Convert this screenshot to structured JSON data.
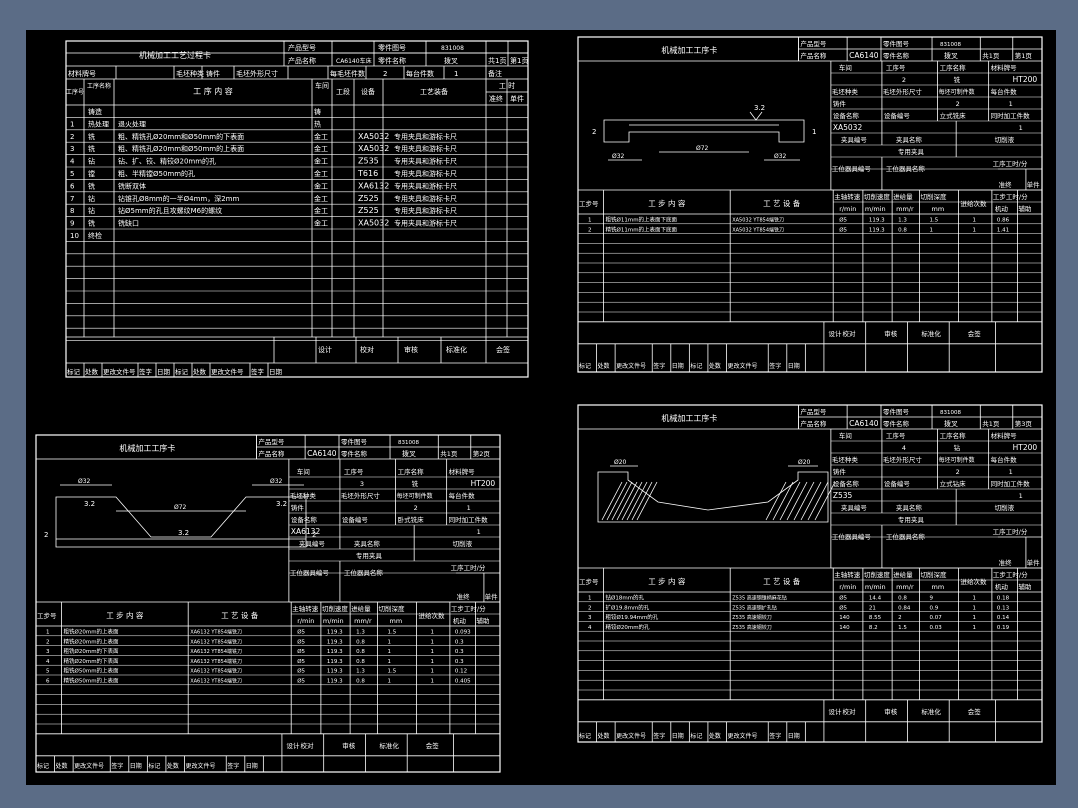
{
  "sheet1": {
    "title": "机械加工工艺过程卡",
    "hdr": {
      "prod_model_lbl": "产品型号",
      "part_no_lbl": "零件图号",
      "part_no": "831008",
      "prod_name_lbl": "产品名称",
      "prod_name": "CA6140车床",
      "part_name_lbl": "零件名称",
      "part_name": "拨叉",
      "total_pages": "共1页",
      "page_no": "第1页",
      "material_lbl": "材料牌号",
      "blank_type_lbl": "毛坯种类",
      "blank_type": "铸件",
      "blank_dim_lbl": "毛坯外形尺寸",
      "per_blank_lbl": "每毛坯件数",
      "per_blank": "2",
      "per_unit_lbl": "每台件数",
      "per_unit": "1",
      "remark_lbl": "备注"
    },
    "cols": {
      "op_no": "工序号",
      "op_name": "工序名称",
      "op_content": "工 序 内 容",
      "workshop": "车间",
      "section": "工段",
      "equipment": "设备",
      "tooling": "工艺装备",
      "time": "工 时",
      "time_final": "准终",
      "time_unit": "单件"
    },
    "rows": [
      {
        "no": "",
        "name": "铸造",
        "content": "",
        "shop": "铸",
        "equip": "",
        "tool": ""
      },
      {
        "no": "1",
        "name": "热处理",
        "content": "退火处理",
        "shop": "热",
        "equip": "",
        "tool": ""
      },
      {
        "no": "2",
        "name": "铣",
        "content": "粗、精铣孔Ø20mm和Ø50mm的下表面",
        "shop": "金工",
        "equip": "XA5032",
        "tool": "专用夹具和游标卡尺"
      },
      {
        "no": "3",
        "name": "铣",
        "content": "粗、精铣孔Ø20mm和Ø50mm的上表面",
        "shop": "金工",
        "equip": "XA5032",
        "tool": "专用夹具和游标卡尺"
      },
      {
        "no": "4",
        "name": "钻",
        "content": "钻、扩、铰、精铰Ø20mm的孔",
        "shop": "金工",
        "equip": "Z535",
        "tool": "专用夹具和游标卡尺"
      },
      {
        "no": "5",
        "name": "镗",
        "content": "粗、半精镗Ø50mm的孔",
        "shop": "金工",
        "equip": "T616",
        "tool": "专用夹具和游标卡尺"
      },
      {
        "no": "6",
        "name": "铣",
        "content": "铣断双体",
        "shop": "金工",
        "equip": "XA6132",
        "tool": "专用夹具和游标卡尺"
      },
      {
        "no": "7",
        "name": "钻",
        "content": "钻锥孔Ø8mm的一半Ø4mm，深2mm",
        "shop": "金工",
        "equip": "Z525",
        "tool": "专用夹具和游标卡尺"
      },
      {
        "no": "8",
        "name": "钻",
        "content": "钻Ø5mm的孔且攻螺纹M6的螺纹",
        "shop": "金工",
        "equip": "Z525",
        "tool": "专用夹具和游标卡尺"
      },
      {
        "no": "9",
        "name": "铣",
        "content": "铣缺口",
        "shop": "金工",
        "equip": "XA5032",
        "tool": "专用夹具和游标卡尺"
      },
      {
        "no": "10",
        "name": "终检",
        "content": "",
        "shop": "",
        "equip": "",
        "tool": ""
      }
    ],
    "sign": {
      "design": "设计",
      "check": "校对",
      "review": "审核",
      "standard": "标准化",
      "countersign": "会签"
    },
    "rev": [
      "标记",
      "处数",
      "更改文件号",
      "签字",
      "日期",
      "标记",
      "处数",
      "更改文件号",
      "签字",
      "日期"
    ]
  },
  "op_cards": [
    {
      "title": "机械加工工序卡",
      "prod_model_lbl": "产品型号",
      "part_no_lbl": "零件图号",
      "part_no": "831008",
      "prod_name_lbl": "产品名称",
      "prod_name": "CA6140",
      "part_name_lbl": "零件名称",
      "part_name": "拨叉",
      "total_pages": "共1页",
      "page_no": "第1页",
      "workshop_lbl": "车间",
      "op_no_lbl": "工序号",
      "op_name_lbl": "工序名称",
      "material_lbl": "材料牌号",
      "op_no": "2",
      "op_name": "铣",
      "material": "HT200",
      "blank_type_lbl": "毛坯种类",
      "blank_dim_lbl": "毛坯外形尺寸",
      "blank_count_lbl": "每坯可制件数",
      "per_unit_lbl": "每台件数",
      "blank_type": "铸件",
      "blank_count": "2",
      "per_unit": "1",
      "equip_name_lbl": "设备名称",
      "equip_model_lbl": "设备编号",
      "concurrent_lbl": "同时加工件数",
      "equip_name": "立式铣床",
      "equip_model": "XA5032",
      "concurrent": "1",
      "fixture_no_lbl": "夹具编号",
      "fixture_name_lbl": "夹具名称",
      "coolant_lbl": "切削液",
      "fixture_name": "专用夹具",
      "tool_no_lbl": "工位器具编号",
      "tool_name_lbl": "工位器具名称",
      "op_time_lbl": "工序工时/分",
      "time_final": "准终",
      "time_unit": "单件",
      "drawing": {
        "roughness": "3.2",
        "d1": "Ø32",
        "d2": "Ø72",
        "d3": "Ø32",
        "l": "2",
        "r": "1"
      },
      "steps": [
        {
          "no": "1",
          "content": "粗铣Ø11mm的上表面下底面",
          "equip": "XA5032  YT854端铣刀",
          "rpm": "Ø5",
          "speed": "119.3",
          "feed": "1.3",
          "depth": "1.5",
          "passes": "1",
          "t": "0.86"
        },
        {
          "no": "2",
          "content": "精铣Ø11mm的上表面下底面",
          "equip": "XA5032  YT854端铣刀",
          "rpm": "Ø5",
          "speed": "119.3",
          "feed": "0.8",
          "depth": "1",
          "passes": "1",
          "t": "1.41"
        }
      ]
    },
    {
      "title": "机械加工工序卡",
      "prod_model_lbl": "产品型号",
      "part_no_lbl": "零件图号",
      "part_no": "831008",
      "prod_name_lbl": "产品名称",
      "prod_name": "CA6140",
      "part_name_lbl": "零件名称",
      "part_name": "拨叉",
      "total_pages": "共1页",
      "page_no": "第2页",
      "workshop_lbl": "车间",
      "op_no_lbl": "工序号",
      "op_name_lbl": "工序名称",
      "material_lbl": "材料牌号",
      "op_no": "3",
      "op_name": "铣",
      "material": "HT200",
      "blank_type_lbl": "毛坯种类",
      "blank_dim_lbl": "毛坯外形尺寸",
      "blank_count_lbl": "每坯可制件数",
      "per_unit_lbl": "每台件数",
      "blank_type": "铸件",
      "blank_count": "2",
      "per_unit": "1",
      "equip_name_lbl": "设备名称",
      "equip_model_lbl": "设备编号",
      "concurrent_lbl": "同时加工件数",
      "equip_name": "卧式铣床",
      "equip_model": "XA6132",
      "concurrent": "1",
      "fixture_no_lbl": "夹具编号",
      "fixture_name_lbl": "夹具名称",
      "coolant_lbl": "切削液",
      "fixture_name": "专用夹具",
      "tool_no_lbl": "工位器具编号",
      "tool_name_lbl": "工位器具名称",
      "op_time_lbl": "工序工时/分",
      "time_final": "准终",
      "time_unit": "单件",
      "drawing": {
        "roughness": "3.2",
        "d1": "Ø32",
        "d2": "Ø72",
        "d3": "Ø32",
        "l": "2",
        "r": "2"
      },
      "steps": [
        {
          "no": "1",
          "content": "粗铣Ø20mm的上表面",
          "equip": "XA6132  YT854端铣刀",
          "rpm": "Ø5",
          "speed": "119.3",
          "feed": "1.3",
          "depth": "1.5",
          "passes": "1",
          "t": "0.093"
        },
        {
          "no": "2",
          "content": "精铣Ø20mm的上表面",
          "equip": "XA6132  YT854端铣刀",
          "rpm": "Ø5",
          "speed": "119.3",
          "feed": "0.8",
          "depth": "1",
          "passes": "1",
          "t": "0.3"
        },
        {
          "no": "3",
          "content": "粗铣Ø20mm的下表面",
          "equip": "XA6132  YT854端铣刀",
          "rpm": "Ø5",
          "speed": "119.3",
          "feed": "0.8",
          "depth": "1",
          "passes": "1",
          "t": "0.3"
        },
        {
          "no": "4",
          "content": "精铣Ø20mm的下表面",
          "equip": "XA6132  YT854端铣刀",
          "rpm": "Ø5",
          "speed": "119.3",
          "feed": "0.8",
          "depth": "1",
          "passes": "1",
          "t": "0.3"
        },
        {
          "no": "5",
          "content": "粗铣Ø50mm的上表面",
          "equip": "XA6132  YT854端铣刀",
          "rpm": "Ø5",
          "speed": "119.3",
          "feed": "1.3",
          "depth": "1.5",
          "passes": "1",
          "t": "0.12"
        },
        {
          "no": "6",
          "content": "精铣Ø50mm的上表面",
          "equip": "XA6132  YT854端铣刀",
          "rpm": "Ø5",
          "speed": "119.3",
          "feed": "0.8",
          "depth": "1",
          "passes": "1",
          "t": "0.405"
        }
      ]
    },
    {
      "title": "机械加工工序卡",
      "prod_model_lbl": "产品型号",
      "part_no_lbl": "零件图号",
      "part_no": "831008",
      "prod_name_lbl": "产品名称",
      "prod_name": "CA6140",
      "part_name_lbl": "零件名称",
      "part_name": "拨叉",
      "total_pages": "共1页",
      "page_no": "第3页",
      "workshop_lbl": "车间",
      "op_no_lbl": "工序号",
      "op_name_lbl": "工序名称",
      "material_lbl": "材料牌号",
      "op_no": "4",
      "op_name": "钻",
      "material": "HT200",
      "blank_type_lbl": "毛坯种类",
      "blank_dim_lbl": "毛坯外形尺寸",
      "blank_count_lbl": "每坯可制件数",
      "per_unit_lbl": "每台件数",
      "blank_type": "铸件",
      "blank_count": "2",
      "per_unit": "1",
      "equip_name_lbl": "设备名称",
      "equip_model_lbl": "设备编号",
      "concurrent_lbl": "同时加工件数",
      "equip_name": "立式钻床",
      "equip_model": "Z535",
      "concurrent": "1",
      "fixture_no_lbl": "夹具编号",
      "fixture_name_lbl": "夹具名称",
      "coolant_lbl": "切削液",
      "fixture_name": "专用夹具",
      "tool_no_lbl": "工位器具编号",
      "tool_name_lbl": "工位器具名称",
      "op_time_lbl": "工序工时/分",
      "time_final": "准终",
      "time_unit": "单件",
      "drawing": {
        "roughness": "",
        "d1": "Ø20",
        "d2": "",
        "d3": "Ø20",
        "l": "",
        "r": ""
      },
      "steps": [
        {
          "no": "1",
          "content": "钻Ø18mm的孔",
          "equip": "Z535  高速钢锥柄麻花钻",
          "rpm": "Ø5",
          "speed": "14.4",
          "feed": "0.8",
          "depth": "9",
          "passes": "1",
          "t": "0.18"
        },
        {
          "no": "2",
          "content": "扩Ø19.8mm的孔",
          "equip": "Z535  高速钢扩孔钻",
          "rpm": "Ø5",
          "speed": "21",
          "feed": "0.84",
          "depth": "0.9",
          "passes": "1",
          "t": "0.13"
        },
        {
          "no": "3",
          "content": "粗铰Ø19.94mm的孔",
          "equip": "Z535  高速钢铰刀",
          "rpm": "140",
          "speed": "8.55",
          "feed": "2",
          "depth": "0.07",
          "passes": "1",
          "t": "0.14"
        },
        {
          "no": "4",
          "content": "精铰Ø20mm的孔",
          "equip": "Z535  高速钢铰刀",
          "rpm": "140",
          "speed": "8.2",
          "feed": "1.5",
          "depth": "0.03",
          "passes": "1",
          "t": "0.19"
        }
      ]
    }
  ],
  "step_cols": {
    "no": "工步号",
    "content": "工 步 内 容",
    "equip": "工 艺 设 备",
    "rpm": "主轴转速",
    "rpm_u": "r/min",
    "speed": "切削速度",
    "speed_u": "m/min",
    "feed": "进给量",
    "feed_u": "mm/r",
    "depth": "切削深度",
    "depth_u": "mm",
    "passes": "进给次数",
    "time": "工步工时/分",
    "t_mach": "机动",
    "t_aux": "辅助"
  },
  "card_sign": {
    "design": "设计",
    "check": "校对",
    "review": "审核",
    "standard": "标准化",
    "countersign": "会签"
  },
  "card_rev": [
    "标记",
    "处数",
    "更改文件号",
    "签字",
    "日期",
    "标记",
    "处数",
    "更改文件号",
    "签字",
    "日期"
  ]
}
